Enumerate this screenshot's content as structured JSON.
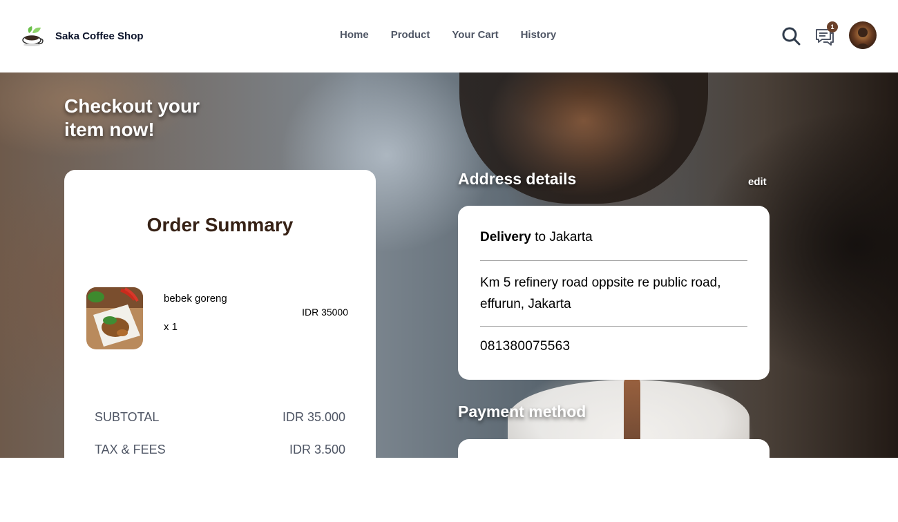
{
  "header": {
    "brand_name": "Saka Coffee Shop",
    "nav": [
      "Home",
      "Product",
      "Your Cart",
      "History"
    ],
    "chat_badge_count": "1",
    "icons": {
      "brand": "coffee-cup-leaf-icon",
      "search": "search-icon",
      "chat": "chat-icon",
      "avatar": "user-avatar"
    }
  },
  "hero": {
    "title": "Checkout your item now!"
  },
  "order_summary": {
    "title": "Order Summary",
    "items": [
      {
        "name": "bebek goreng",
        "quantity": "x 1",
        "price": "IDR 35000"
      }
    ],
    "totals": [
      {
        "label": "SUBTOTAL",
        "value": "IDR 35.000"
      },
      {
        "label": "TAX & FEES",
        "value": "IDR 3.500"
      }
    ]
  },
  "address": {
    "heading": "Address details",
    "edit_label": "edit",
    "delivery_bold": "Delivery",
    "delivery_rest": " to Jakarta",
    "street": "Km 5 refinery road oppsite re public road, effurun, Jakarta",
    "phone": "081380075563"
  },
  "payment": {
    "heading": "Payment method"
  },
  "colors": {
    "brand_dark": "#362115",
    "nav_text": "#4f5665",
    "badge": "#6a4029"
  }
}
